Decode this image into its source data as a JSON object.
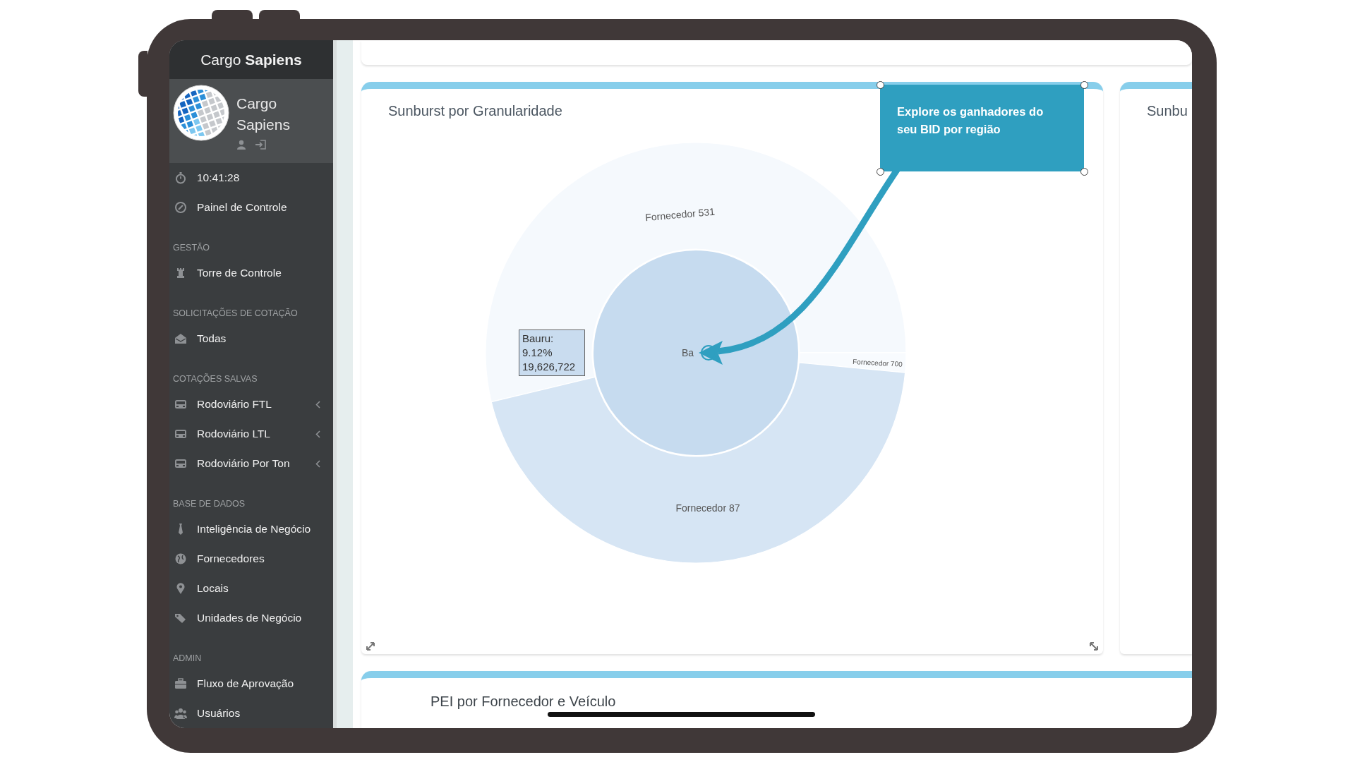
{
  "brand": "Cargo **Sapiens**",
  "profile": {
    "name": "Cargo Sapiens"
  },
  "sidebar": [
    {
      "kind": "clock",
      "label": "10:41:28"
    },
    {
      "kind": "link",
      "label": "Painel de Controle",
      "submenu": false
    },
    {
      "kind": "header",
      "label": "GESTÃO"
    },
    {
      "kind": "link",
      "label": "Torre de Controle",
      "submenu": false
    },
    {
      "kind": "header",
      "label": "SOLICITAÇÕES DE COTAÇÃO"
    },
    {
      "kind": "link",
      "label": "Todas",
      "submenu": false
    },
    {
      "kind": "header",
      "label": "COTAÇÕES SALVAS"
    },
    {
      "kind": "link",
      "label": "Rodoviário FTL",
      "submenu": true
    },
    {
      "kind": "link",
      "label": "Rodoviário LTL",
      "submenu": true
    },
    {
      "kind": "link",
      "label": "Rodoviário Por Ton",
      "submenu": true
    },
    {
      "kind": "header",
      "label": "BASE DE DADOS"
    },
    {
      "kind": "link",
      "label": "Inteligência de Negócio",
      "submenu": false
    },
    {
      "kind": "link",
      "label": "Fornecedores",
      "submenu": false
    },
    {
      "kind": "link",
      "label": "Locais",
      "submenu": false
    },
    {
      "kind": "link",
      "label": "Unidades de Negócio",
      "submenu": false
    },
    {
      "kind": "header",
      "label": "ADMIN"
    },
    {
      "kind": "link",
      "label": "Fluxo de Aprovação",
      "submenu": false
    },
    {
      "kind": "link",
      "label": "Usuários",
      "submenu": false
    }
  ],
  "main_card": {
    "title": "Sunburst por Granularidade",
    "sunburst": {
      "center_label": "Ba",
      "segments": [
        {
          "label": "Fornecedor 531",
          "color": "#f5f9fd"
        },
        {
          "label": "Fornecedor 700",
          "color": "#f8fbfe"
        },
        {
          "label": "Fornecedor 87",
          "color": "#d6e5f4"
        }
      ]
    },
    "tooltip": {
      "lines": [
        "Bauru:",
        "9.12%",
        "19,626,722"
      ]
    },
    "annotation": {
      "text": "Explore os ganhadores do seu BID por região"
    }
  },
  "side_card": {
    "title": "Sunbu"
  },
  "bottom_card": {
    "title": "PEI por Fornecedor e Veículo"
  }
}
